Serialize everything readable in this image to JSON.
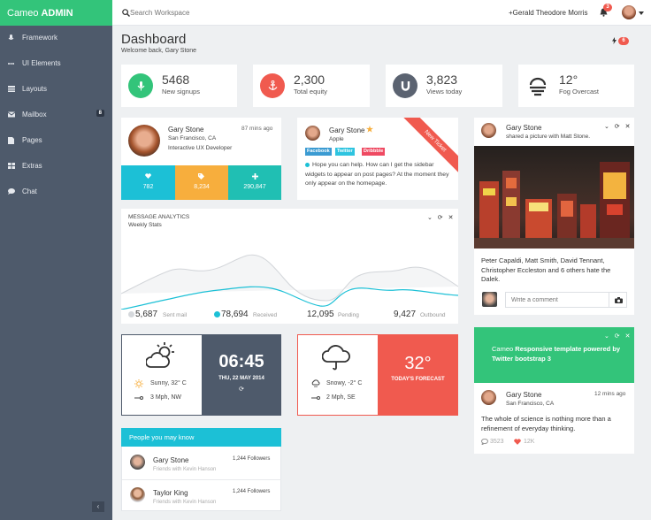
{
  "brand": {
    "name": "Cameo",
    "bold": "ADMIN"
  },
  "sidebar": {
    "items": [
      {
        "label": "Framework",
        "icon": "microphone-icon"
      },
      {
        "label": "UI Elements",
        "icon": "dots-icon"
      },
      {
        "label": "Layouts",
        "icon": "layouts-icon"
      },
      {
        "label": "Mailbox",
        "icon": "mailbox-icon",
        "badge": "8"
      },
      {
        "label": "Pages",
        "icon": "pages-icon"
      },
      {
        "label": "Extras",
        "icon": "extras-icon"
      },
      {
        "label": "Chat",
        "icon": "chat-icon"
      }
    ],
    "collapse": "‹"
  },
  "topbar": {
    "search_placeholder": "Search Workspace",
    "user_name": "+Gerald Theodore Morris",
    "notification_count": "3"
  },
  "page": {
    "title": "Dashboard",
    "subtitle": "Welcome back, Gary Stone",
    "alert_count": "6"
  },
  "stats": [
    {
      "value": "5468",
      "label": "New signups",
      "color": "#33c47a",
      "icon": "microphone-icon"
    },
    {
      "value": "2,300",
      "label": "Total equity",
      "color": "#f05a4f",
      "icon": "anchor-icon"
    },
    {
      "value": "3,823",
      "label": "Views today",
      "color": "#5b6371",
      "icon": "magnet-icon"
    },
    {
      "value": "12°",
      "label": "Fog Overcast",
      "icon": "fog-icon"
    }
  ],
  "profile": {
    "name": "Gary Stone",
    "time": "87 mins ago",
    "location": "San Francisco, CA",
    "role": "Interactive UX Developer",
    "metrics": [
      {
        "value": "782",
        "icon": "heart-icon",
        "color": "#1cc0d6"
      },
      {
        "value": "8,234",
        "icon": "tag-icon",
        "color": "#f7ae3d"
      },
      {
        "value": "290,847",
        "icon": "plus-icon",
        "color": "#20bfb3"
      }
    ]
  },
  "post": {
    "name": "Gary Stone",
    "company": "Apple",
    "ribbon": "New Ticket",
    "tags": [
      {
        "label": "Facebook",
        "color": "#3b9bd2"
      },
      {
        "label": "Twitter",
        "color": "#2ec4e0"
      },
      {
        "label": "Dribbble",
        "color": "#ef4a62"
      }
    ],
    "text": "Hope you can help. How can I get the sidebar widgets to appear on post pages? At the moment they only appear on the homepage."
  },
  "analytics": {
    "title": "MESSAGE ANALYTICS",
    "subtitle": "Weekly Stats",
    "controls": "⌄ ⟳ ✕",
    "legend": [
      {
        "value": "5,687",
        "label": "Sent mail",
        "color": "#d5d8dc"
      },
      {
        "value": "78,694",
        "label": "Received",
        "color": "#1cc0d6"
      },
      {
        "value": "12,095",
        "label": "Pending"
      },
      {
        "value": "9,427",
        "label": "Outbound"
      }
    ]
  },
  "weather1": {
    "condition": "Sunny, 32° C",
    "wind": "3 Mph, NW",
    "time": "06:45",
    "date": "THU, 22 MAY 2014",
    "refresh": "⟳"
  },
  "weather2": {
    "condition": "Snowy, -2° C",
    "wind": "2 Mph, SE",
    "temp": "32°",
    "label": "TODAY'S FORECAST"
  },
  "people": {
    "title": "People you may know",
    "items": [
      {
        "name": "Gary Stone",
        "sub": "Friends with Kevin Hanson",
        "followers": "1,244 Followers"
      },
      {
        "name": "Taylor King",
        "sub": "Friends with Kevin Hanson",
        "followers": "1,244 Followers"
      }
    ]
  },
  "photo": {
    "name": "Gary Stone",
    "action": "shared a picture with Matt Stone.",
    "controls": "⌄ ⟳ ✕",
    "caption": "Peter Capaldi, Matt Smith, David Tennant, Christopher Eccleston and 6 others hate the Dalek.",
    "comment_placeholder": "Write a comment"
  },
  "promo": {
    "prefix": "Cameo",
    "text": "Responsive template powered by Twitter bootstrap 3",
    "controls": "⌄ ⟳ ✕"
  },
  "tweet": {
    "name": "Gary Stone",
    "location": "San Francisco, CA",
    "time": "12 mins ago",
    "text": "The whole of science is nothing more than a refinement of everyday thinking.",
    "comments": "3523",
    "likes": "12K"
  }
}
